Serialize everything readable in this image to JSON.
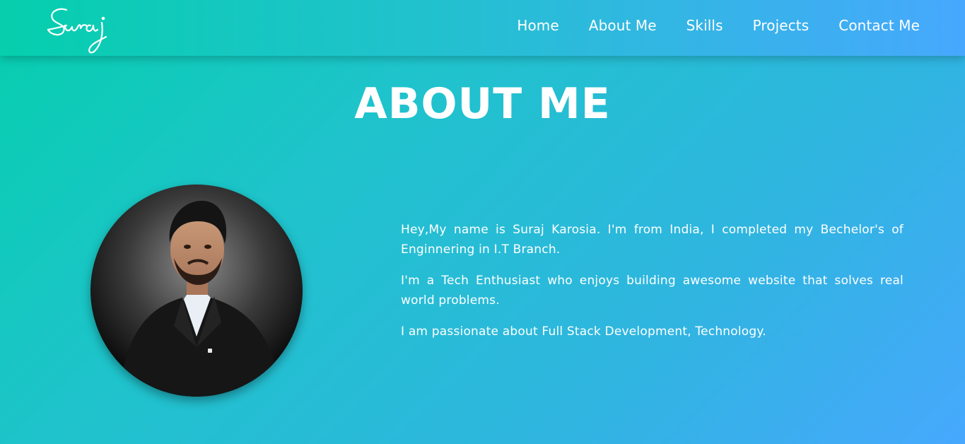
{
  "brand": {
    "logo_text": "Suraj"
  },
  "nav": {
    "items": [
      {
        "label": "Home"
      },
      {
        "label": "About Me"
      },
      {
        "label": "Skills"
      },
      {
        "label": "Projects"
      },
      {
        "label": "Contact Me"
      }
    ]
  },
  "about": {
    "title": "ABOUT ME",
    "paragraphs": [
      "Hey,My name is Suraj Karosia. I'm from India, I completed my Bechelor's of Enginnering in I.T Branch.",
      "I'm a Tech Enthusiast who enjoys building awesome website that solves real world problems.",
      "I am passionate about Full Stack Development, Technology."
    ]
  },
  "colors": {
    "gradient_start": "#05cfad",
    "gradient_end": "#47a8fd",
    "text": "#ffffff"
  }
}
